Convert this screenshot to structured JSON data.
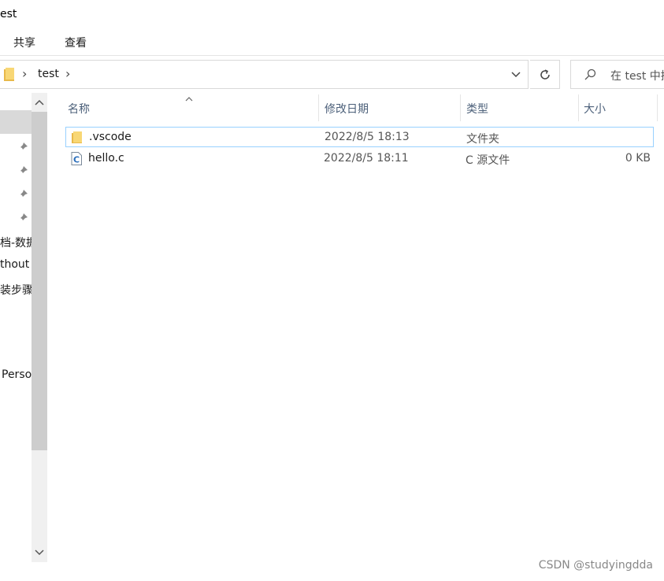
{
  "window": {
    "title": "est"
  },
  "ribbon": {
    "tabs": [
      {
        "label": "共享"
      },
      {
        "label": "查看"
      }
    ]
  },
  "address": {
    "path": "test",
    "search_placeholder": "在 test 中搜"
  },
  "nav": {
    "items": [
      {
        "label": "档-数据"
      },
      {
        "label": "thout"
      },
      {
        "label": "装步骤"
      },
      {
        "label": "Perso"
      }
    ]
  },
  "columns": {
    "name": "名称",
    "date": "修改日期",
    "type": "类型",
    "size": "大小"
  },
  "files": [
    {
      "name": ".vscode",
      "date": "2022/8/5 18:13",
      "type": "文件夹",
      "size": "",
      "icon": "folder-icon"
    },
    {
      "name": "hello.c",
      "date": "2022/8/5 18:11",
      "type": "C 源文件",
      "size": "0 KB",
      "icon": "c-file-icon"
    }
  ],
  "watermark": "CSDN @studyingdda",
  "colors": {
    "selection_border": "#99d1ff",
    "folder": "#f8d775",
    "header_text": "#4c607a"
  }
}
